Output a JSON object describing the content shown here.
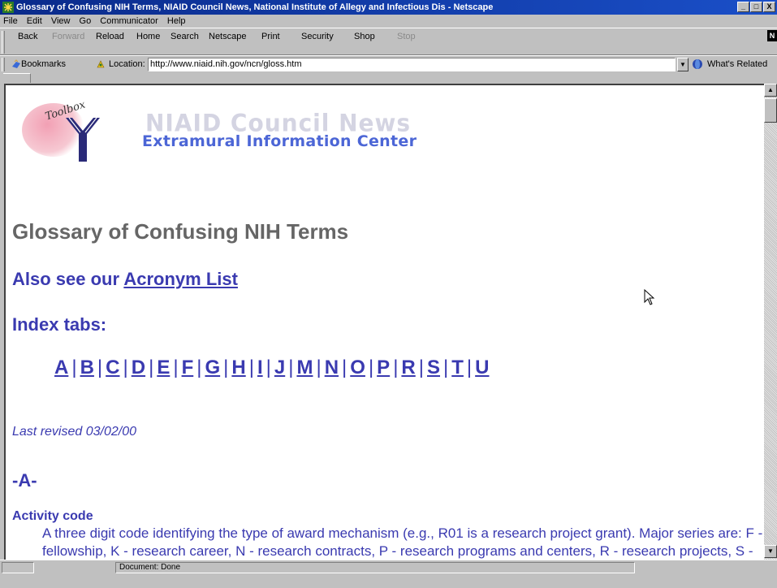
{
  "window": {
    "title": "Glossary of Confusing NIH Terms, NIAID Council News, National Institute of Allegy and Infectious Dis - Netscape",
    "min_glyph": "_",
    "max_glyph": "□",
    "close_glyph": "X"
  },
  "menu": [
    "File",
    "Edit",
    "View",
    "Go",
    "Communicator",
    "Help"
  ],
  "nav_buttons": [
    {
      "label": "Back",
      "enabled": true
    },
    {
      "label": "Forward",
      "enabled": false
    },
    {
      "label": "Reload",
      "enabled": true
    },
    {
      "label": "Home",
      "enabled": true
    },
    {
      "label": "Search",
      "enabled": true
    },
    {
      "label": "Netscape",
      "enabled": true
    },
    {
      "label": "Print",
      "enabled": true
    },
    {
      "label": "Security",
      "enabled": true
    },
    {
      "label": "Shop",
      "enabled": true
    },
    {
      "label": "Stop",
      "enabled": false
    }
  ],
  "netscape_logo": "N",
  "location": {
    "bookmarks_label": "Bookmarks",
    "location_label": "Location:",
    "url": "http://www.niaid.nih.gov/ncn/gloss.htm",
    "related_label": "What's Related"
  },
  "page": {
    "logo": {
      "toolbox_text": "Toolbox",
      "council_news": "NIAID Council News",
      "eic": "Extramural Information Center"
    },
    "heading": "Glossary of Confusing NIH Terms",
    "also_prefix": "Also see our ",
    "acronym_link": "Acronym List",
    "index_label": "Index tabs:",
    "index_letters": [
      "A",
      "B",
      "C",
      "D",
      "E",
      "F",
      "G",
      "H",
      "I",
      "J",
      "M",
      "N",
      "O",
      "P",
      "R",
      "S",
      "T",
      "U"
    ],
    "revised": "Last revised 03/02/00",
    "section_a": "-A-",
    "first_term": "Activity code",
    "first_def": "A three digit code identifying the type of award mechanism (e.g., R01 is a research project grant). Major series are: F - fellowship, K - research career, N - research contracts, P - research programs and centers, R - research projects, S - research-related programs, T - training, U - cooperative"
  },
  "status": {
    "text": "Document: Done"
  },
  "colors": {
    "link": "#3a3ab0",
    "heading_gray": "#666666",
    "eic_blue": "#4c66d6",
    "titlebar": "#0a2a8a"
  }
}
